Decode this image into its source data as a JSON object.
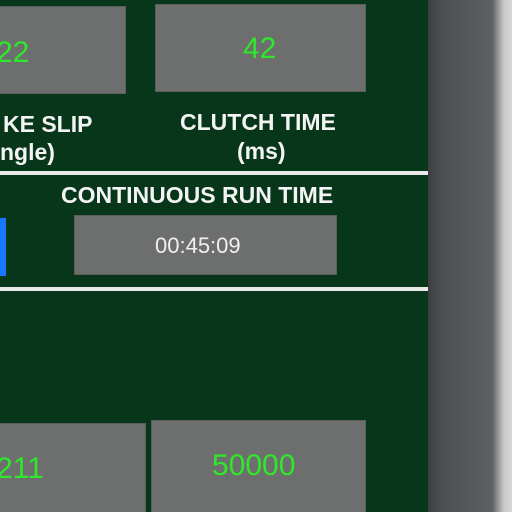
{
  "gauges": {
    "brake_slip": {
      "value": "22",
      "label_line1": "KE SLIP",
      "label_line2": "ngle)"
    },
    "clutch_time": {
      "value": "42",
      "label_line1": "CLUTCH TIME",
      "label_line2": "(ms)"
    },
    "continuous_run_time": {
      "label": "CONTINUOUS RUN TIME",
      "value": "00:45:09"
    },
    "bottom_left": {
      "value": "211"
    },
    "bottom_right": {
      "value": "50000"
    }
  },
  "colors": {
    "panel_background": "#08361a",
    "value_green": "#2fe82a",
    "box_gray": "#6d6e6e",
    "indicator_blue": "#1677ff"
  }
}
